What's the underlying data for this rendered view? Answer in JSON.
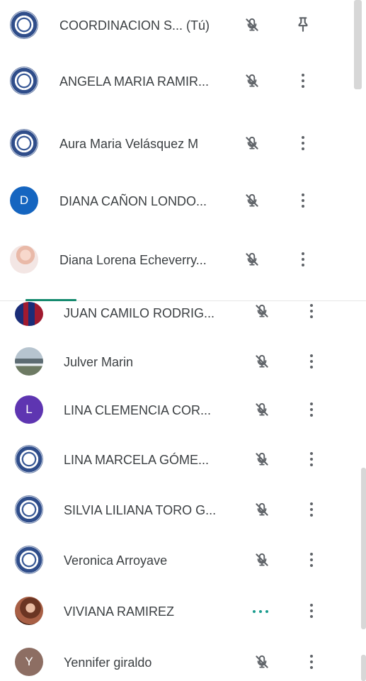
{
  "participants": [
    {
      "name": "COORDINACION S...",
      "suffix": "(Tú)",
      "avatar": "seal",
      "initial": "",
      "action": "pin-icon",
      "status": "mic-off-icon"
    },
    {
      "name": "ANGELA MARIA RAMIR...",
      "avatar": "seal",
      "initial": "",
      "action": "more-options-icon",
      "status": "mic-off-icon"
    },
    {
      "name": "Aura Maria Velásquez M",
      "avatar": "seal",
      "initial": "",
      "action": "more-options-icon",
      "status": "mic-off-icon"
    },
    {
      "name": "DIANA CAÑON LONDO...",
      "avatar": "initial",
      "initial": "D",
      "avatar_color": "#1565c0",
      "action": "more-options-icon",
      "status": "mic-off-icon"
    },
    {
      "name": "Diana Lorena Echeverry...",
      "avatar": "photo-pink",
      "initial": "",
      "action": "more-options-icon",
      "status": "mic-off-icon"
    },
    {
      "name": "JUAN CAMILO RODRIG...",
      "avatar": "photo-football",
      "initial": "",
      "action": "more-options-icon",
      "status": "mic-off-icon"
    },
    {
      "name": "Julver Marin",
      "avatar": "photo-landscape",
      "initial": "",
      "action": "more-options-icon",
      "status": "mic-off-icon"
    },
    {
      "name": "LINA CLEMENCIA COR...",
      "avatar": "initial",
      "initial": "L",
      "avatar_color": "#5e35b1",
      "action": "more-options-icon",
      "status": "mic-off-icon"
    },
    {
      "name": "LINA MARCELA GÓME...",
      "avatar": "seal",
      "initial": "",
      "action": "more-options-icon",
      "status": "mic-off-icon"
    },
    {
      "name": "SILVIA LILIANA TORO G...",
      "avatar": "seal",
      "initial": "",
      "action": "more-options-icon",
      "status": "mic-off-icon"
    },
    {
      "name": "Veronica Arroyave",
      "avatar": "seal",
      "initial": "",
      "action": "more-options-icon",
      "status": "mic-off-icon"
    },
    {
      "name": "VIVIANA RAMIREZ",
      "avatar": "photo-woman",
      "initial": "",
      "action": "more-options-icon",
      "status": "speaking-icon"
    },
    {
      "name": "Yennifer giraldo",
      "avatar": "initial",
      "initial": "Y",
      "avatar_color": "#8d6e63",
      "action": "more-options-icon",
      "status": "mic-off-icon"
    }
  ],
  "colors": {
    "text": "#3c4043",
    "icon": "#5f6368",
    "speaking": "#1a9c8e",
    "divider_accent": "#158a6e"
  }
}
